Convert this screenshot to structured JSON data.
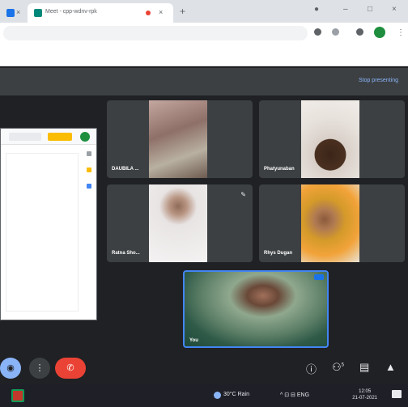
{
  "browser": {
    "tab_title": "Meet - cpp-wdnv-rpk",
    "new_tab": "+",
    "close": "×",
    "minimize": "–",
    "maximize": "□",
    "win_close": "×"
  },
  "meet": {
    "stop_presenting": "Stop presenting"
  },
  "participants": [
    {
      "name": "DAUBILA ...",
      "pinned": false
    },
    {
      "name": "Phatyunaban",
      "pinned": false
    },
    {
      "name": "Ratna Sho...",
      "pinned": true
    },
    {
      "name": "Rhys Dugan",
      "pinned": false
    }
  ],
  "self_view": {
    "name": "You"
  },
  "controls": {
    "camera_icon": "◉",
    "more_icon": "⋮",
    "end_call_icon": "✆",
    "info_icon": "ⓘ",
    "people_count": "5",
    "chat_icon": "▤",
    "activities_icon": "▲"
  },
  "taskbar": {
    "weather": "30°C Rain",
    "tray": "^ ⊡ ⊟ ENG",
    "time": "12:05",
    "date": "21-07-2021"
  },
  "colors": {
    "meet_bg": "#202124",
    "tile_bg": "#3c4043",
    "end_call": "#ea4335",
    "accent": "#8ab4f8",
    "self_border": "#4285f4"
  }
}
